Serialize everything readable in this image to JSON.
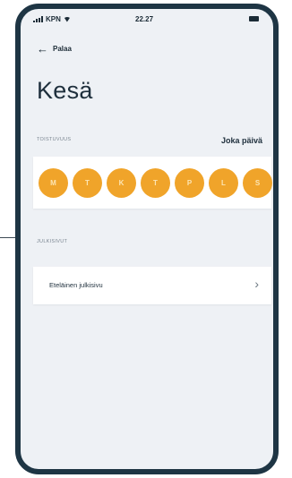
{
  "status": {
    "carrier": "KPN",
    "time": "22.27"
  },
  "nav": {
    "back_label": "Palaa"
  },
  "page": {
    "title": "Kesä"
  },
  "repeat": {
    "section_label": "TOISTUVUUS",
    "value": "Joka päivä",
    "days": [
      "M",
      "T",
      "K",
      "T",
      "P",
      "L",
      "S"
    ],
    "day_color": "#f0a42a"
  },
  "regions": {
    "section_label": "JULKISIVUT",
    "items": [
      {
        "label": "Eteläinen julkisivu"
      }
    ]
  }
}
